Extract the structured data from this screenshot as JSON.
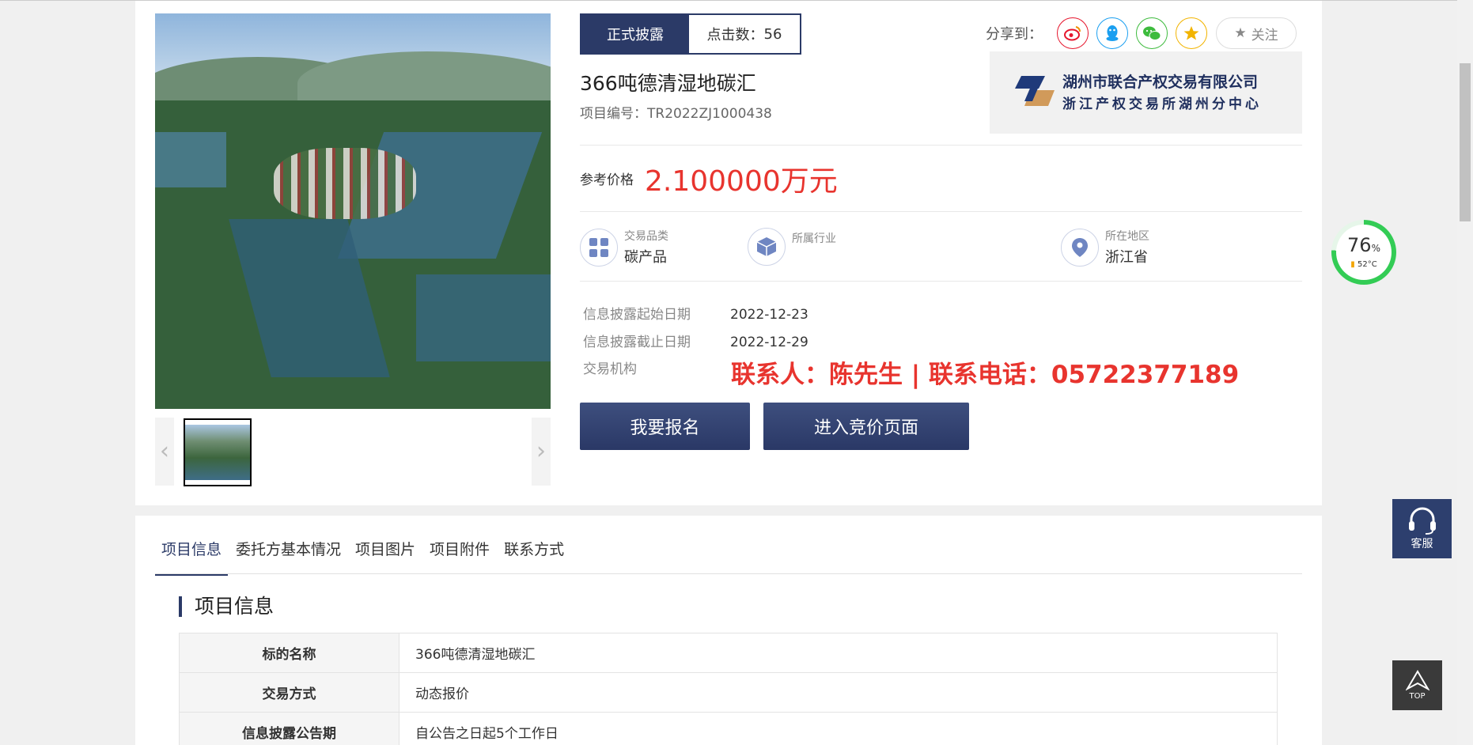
{
  "status": {
    "active_label": "正式披露",
    "clicks_label": "点击数：",
    "clicks_value": "56"
  },
  "project": {
    "title": "366吨德清湿地碳汇",
    "number_label": "项目编号：",
    "number": "TR2022ZJ1000438"
  },
  "share": {
    "label": "分享到：",
    "follow_label": "关注",
    "icons": [
      "weibo-icon",
      "qq-icon",
      "wechat-icon",
      "qzone-icon"
    ]
  },
  "org": {
    "name_line1": "湖州市联合产权交易有限公司",
    "name_line2": "浙江产权交易所湖州分中心"
  },
  "price": {
    "label": "参考价格",
    "value": "2.100000万元"
  },
  "attributes": [
    {
      "caption": "交易品类",
      "value": "碳产品"
    },
    {
      "caption": "所属行业",
      "value": ""
    },
    {
      "caption": "所在地区",
      "value": "浙江省"
    }
  ],
  "info": {
    "start_label": "信息披露起始日期",
    "start_value": "2022-12-23",
    "end_label": "信息披露截止日期",
    "end_value": "2022-12-29",
    "org_label": "交易机构",
    "contact": "联系人：陈先生 | 联系电话：05722377189"
  },
  "buttons": {
    "signup": "我要报名",
    "bid": "进入竞价页面"
  },
  "tabs": [
    "项目信息",
    "委托方基本情况",
    "项目图片",
    "项目附件",
    "联系方式"
  ],
  "section_title": "项目信息",
  "table": [
    {
      "key": "标的名称",
      "value": "366吨德清湿地碳汇"
    },
    {
      "key": "交易方式",
      "value": "动态报价"
    },
    {
      "key": "信息披露公告期",
      "value": "自公告之日起5个工作日"
    }
  ],
  "gauge": {
    "percent": "76",
    "percent_sign": "%",
    "temp": "52°C",
    "level": 0.76
  },
  "widgets": {
    "service_label": "客服",
    "top_label": "TOP"
  },
  "colors": {
    "primary": "#2b3a67",
    "price_red": "#e8342e"
  }
}
